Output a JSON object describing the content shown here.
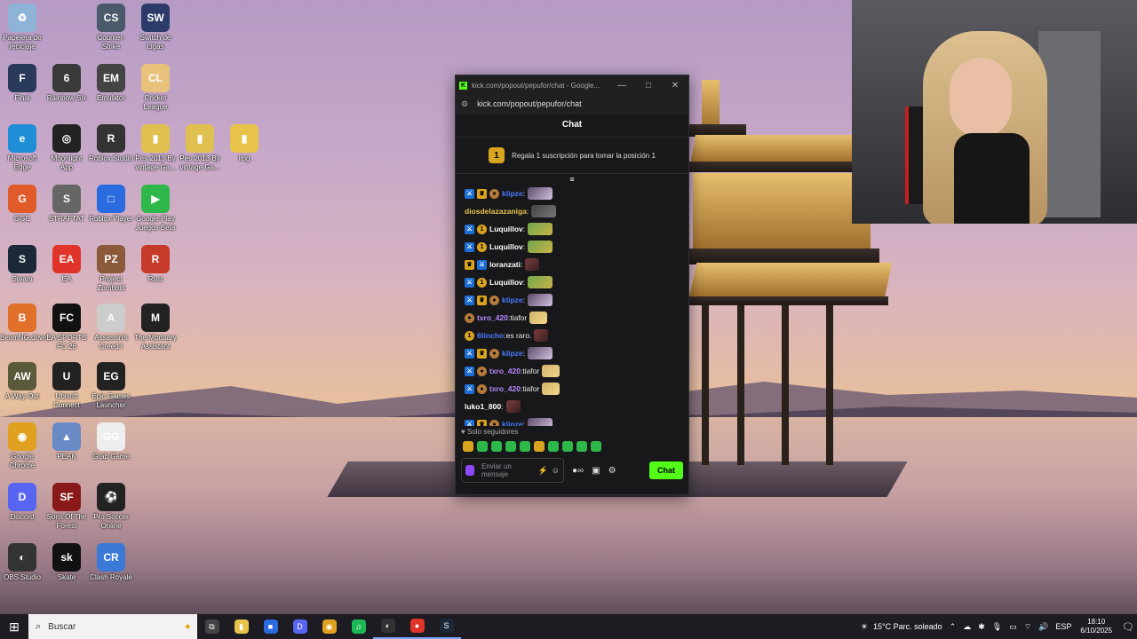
{
  "desktop": {
    "icons": [
      {
        "label": "Papelera de reciclaje",
        "color": "#8fb3d6",
        "glyph": "♻"
      },
      {
        "label": "Counter-Strike",
        "color": "#4a5a6a",
        "glyph": "CS"
      },
      {
        "label": "Switch de Ligas",
        "color": "#2c3b6a",
        "glyph": "SW"
      },
      {
        "label": "Final",
        "color": "#2a3a5a",
        "glyph": "F"
      },
      {
        "label": "Rainbow Six",
        "color": "#3a3a3a",
        "glyph": "6"
      },
      {
        "label": "Emulator",
        "color": "#444",
        "glyph": "EM"
      },
      {
        "label": "Cricket League",
        "color": "#e8c27a",
        "glyph": "CL"
      },
      {
        "label": "Microsoft Edge",
        "color": "#1e8fd6",
        "glyph": "e"
      },
      {
        "label": "Moonlight App",
        "color": "#222",
        "glyph": "◎"
      },
      {
        "label": "Roblox Studio",
        "color": "#333",
        "glyph": "R"
      },
      {
        "label": "Pes 2013 By vintage Ga...",
        "color": "#e0c050",
        "glyph": "▮"
      },
      {
        "label": "Pes 2013 By vintage Ga...",
        "color": "#e0c050",
        "glyph": "▮"
      },
      {
        "label": "img",
        "color": "#e8c34a",
        "glyph": "▮"
      },
      {
        "label": "GGC",
        "color": "#e05a2a",
        "glyph": "G"
      },
      {
        "label": "STRAFTAT",
        "color": "#666",
        "glyph": "S"
      },
      {
        "label": "Roblox Player",
        "color": "#2b6be0",
        "glyph": "□"
      },
      {
        "label": "Google Play Juegos Beta",
        "color": "#2fb84a",
        "glyph": "▶"
      },
      {
        "label": "Steam",
        "color": "#1b2838",
        "glyph": "S"
      },
      {
        "label": "EA",
        "color": "#e0332a",
        "glyph": "EA"
      },
      {
        "label": "Project Zomboid",
        "color": "#8a5a3a",
        "glyph": "PZ"
      },
      {
        "label": "Rust",
        "color": "#c63a2a",
        "glyph": "R"
      },
      {
        "label": "BeamNG.drive",
        "color": "#e0702a",
        "glyph": "B"
      },
      {
        "label": "EA SPORTS FC 26",
        "color": "#111",
        "glyph": "FC"
      },
      {
        "label": "Assassin's Creed I",
        "color": "#ccc",
        "glyph": "A"
      },
      {
        "label": "The Mortuary Assistant",
        "color": "#222",
        "glyph": "M"
      },
      {
        "label": "A Way Out",
        "color": "#5a5a3a",
        "glyph": "AW"
      },
      {
        "label": "Ubisoft Connect",
        "color": "#222",
        "glyph": "U"
      },
      {
        "label": "Epic Games Launcher",
        "color": "#222",
        "glyph": "EG"
      },
      {
        "label": "Google Chrome",
        "color": "#e0a020",
        "glyph": "◉"
      },
      {
        "label": "PEAK",
        "color": "#6a8ac6",
        "glyph": "▲"
      },
      {
        "label": "Grab Game",
        "color": "#eee",
        "glyph": "GG"
      },
      {
        "label": "Discord",
        "color": "#5865f2",
        "glyph": "D"
      },
      {
        "label": "Sons Of The Forest",
        "color": "#8a1a1a",
        "glyph": "SF"
      },
      {
        "label": "Pro Soccer Online",
        "color": "#222",
        "glyph": "⚽"
      },
      {
        "label": "OBS Studio",
        "color": "#333",
        "glyph": "◐"
      },
      {
        "label": "Skate",
        "color": "#111",
        "glyph": "sk"
      },
      {
        "label": "Clash Royale",
        "color": "#3a7ad6",
        "glyph": "CR"
      }
    ]
  },
  "chat_window": {
    "title": "kick.com/popout/pepufor/chat - Google...",
    "url": "kick.com/popout/pepufor/chat",
    "header": "Chat",
    "sub_banner": {
      "coin": "1",
      "text": "Regala 1 suscripción para tomar la posición 1"
    },
    "pin_glyph": "≡",
    "messages": [
      {
        "badges": [
          "mod",
          "crown",
          "bronze"
        ],
        "user": "klipze",
        "color": "#4a7aff",
        "text": "",
        "emote": "face"
      },
      {
        "badges": [],
        "user": "diosdelazazaniga",
        "color": "#e6c14a",
        "text": "",
        "emote": "gray"
      },
      {
        "badges": [
          "mod",
          "coin"
        ],
        "user": "Luquillov",
        "color": "#ffffff",
        "text": "",
        "emote": "pepe"
      },
      {
        "badges": [
          "mod",
          "coin"
        ],
        "user": "Luquillov",
        "color": "#ffffff",
        "text": "",
        "emote": "pepe"
      },
      {
        "badges": [
          "crown",
          "mod"
        ],
        "user": "loranzati",
        "color": "#ffffff",
        "text": "",
        "emote": "dark"
      },
      {
        "badges": [
          "mod",
          "coin"
        ],
        "user": "Luquillov",
        "color": "#ffffff",
        "text": "",
        "emote": "pepe"
      },
      {
        "badges": [
          "mod",
          "crown",
          "bronze"
        ],
        "user": "klipze",
        "color": "#4a7aff",
        "text": "",
        "emote": "face"
      },
      {
        "badges": [
          "bronze"
        ],
        "user": "txro_420",
        "color": "#b98aff",
        "text": "tiafor",
        "emote": "cat"
      },
      {
        "badges": [
          "coin"
        ],
        "user": "6tincho",
        "color": "#4a7aff",
        "text": "es raro.",
        "emote": "dark"
      },
      {
        "badges": [
          "mod",
          "crown",
          "bronze"
        ],
        "user": "klipze",
        "color": "#4a7aff",
        "text": "",
        "emote": "face"
      },
      {
        "badges": [
          "mod",
          "bronze"
        ],
        "user": "txro_420",
        "color": "#b98aff",
        "text": "tiafor",
        "emote": "cat"
      },
      {
        "badges": [
          "mod",
          "bronze"
        ],
        "user": "txro_420",
        "color": "#b98aff",
        "text": "tiafor",
        "emote": "cat"
      },
      {
        "badges": [],
        "user": "luko1_800",
        "color": "#ffffff",
        "text": "",
        "emote": "dark"
      },
      {
        "badges": [
          "mod",
          "crown",
          "bronze"
        ],
        "user": "klipze",
        "color": "#4a7aff",
        "text": "",
        "emote": "face"
      }
    ],
    "followers_only": "Solo seguidores",
    "input_placeholder": "Enviar un mensaje",
    "send_label": "Chat"
  },
  "taskbar": {
    "search_placeholder": "Buscar",
    "apps": [
      {
        "name": "task-view",
        "glyph": "⧉",
        "color": "#444"
      },
      {
        "name": "file-explorer",
        "glyph": "▮",
        "color": "#e8c34a"
      },
      {
        "name": "microsoft-store",
        "glyph": "■",
        "color": "#2b6be0"
      },
      {
        "name": "discord-app",
        "glyph": "D",
        "color": "#5865f2"
      },
      {
        "name": "chrome",
        "glyph": "◉",
        "color": "#e0a020"
      },
      {
        "name": "spotify",
        "glyph": "♫",
        "color": "#1db954"
      },
      {
        "name": "obs",
        "glyph": "◐",
        "color": "#333"
      },
      {
        "name": "game-app",
        "glyph": "●",
        "color": "#e0332a"
      },
      {
        "name": "steam-app",
        "glyph": "S",
        "color": "#1b2838"
      }
    ],
    "weather": "15°C  Parc. soleado",
    "language": "ESP",
    "time": "18:10",
    "date": "6/10/2025"
  }
}
